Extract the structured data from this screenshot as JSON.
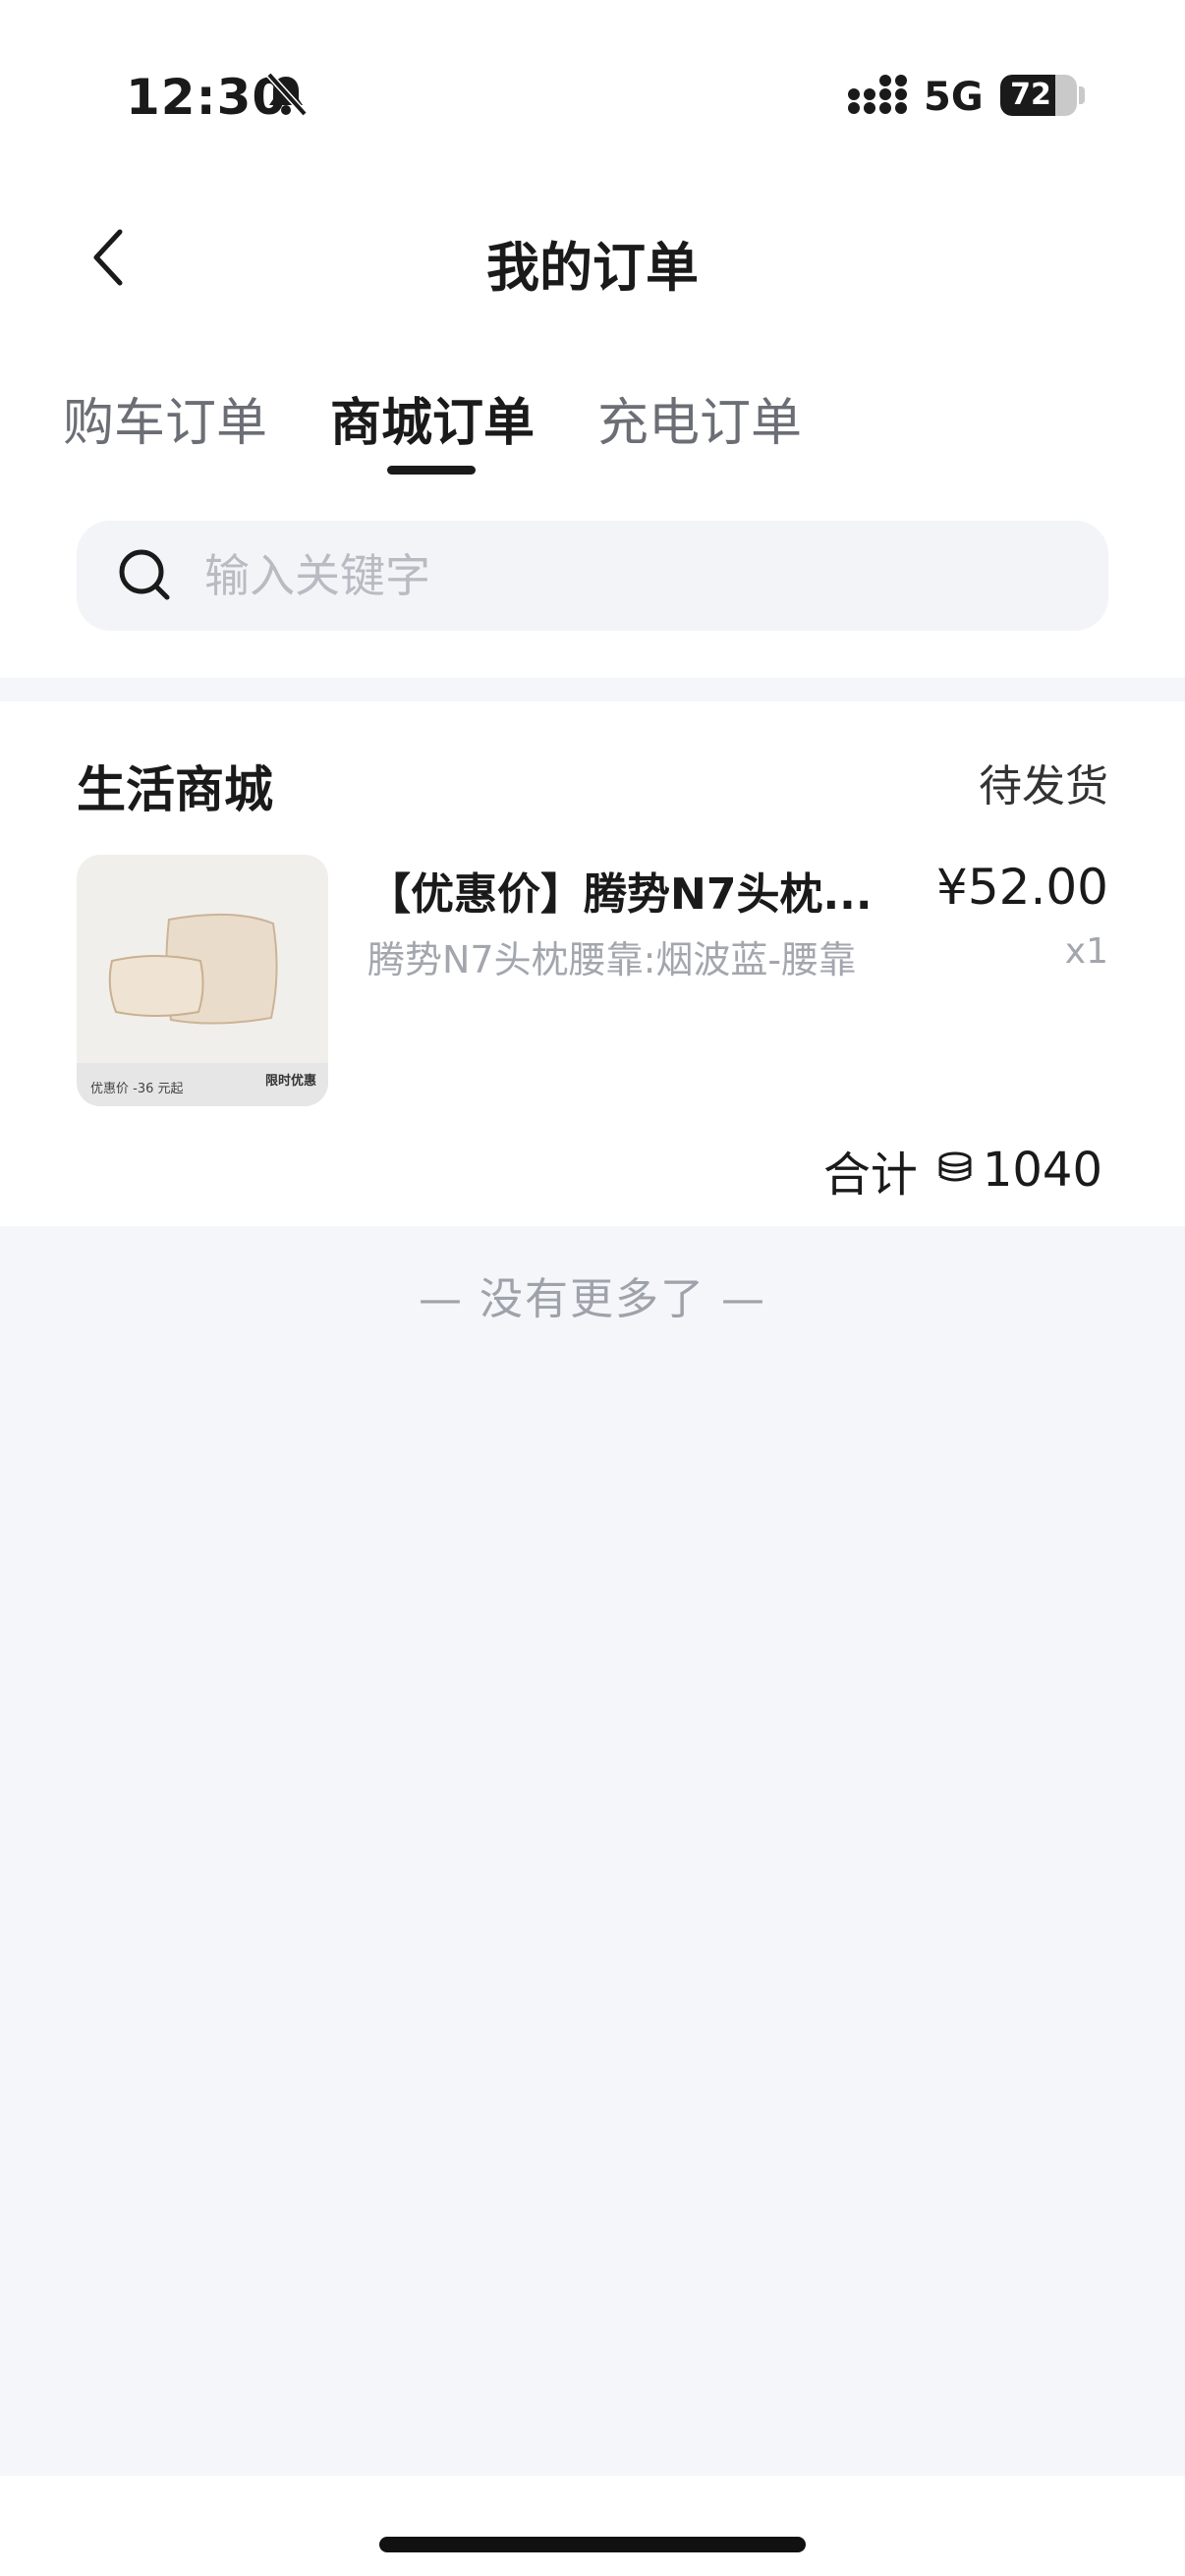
{
  "status_bar": {
    "time": "12:30",
    "network": "5G",
    "battery": "72",
    "battery_level": 0.72
  },
  "header": {
    "title": "我的订单"
  },
  "tabs": [
    {
      "label": "购车订单",
      "active": false
    },
    {
      "label": "商城订单",
      "active": true
    },
    {
      "label": "充电订单",
      "active": false
    }
  ],
  "search": {
    "placeholder": "输入关键字",
    "value": ""
  },
  "order": {
    "store": "生活商城",
    "status": "待发货",
    "product": {
      "name": "【优惠价】腾势N7头枕...",
      "price": "¥52.00",
      "variant": "腾势N7头枕腰靠:烟波蓝-腰靠",
      "quantity": "x1",
      "image_banner_left": "优惠价 -36 元起",
      "image_banner_right": "限时优惠"
    },
    "total_label": "合计",
    "total_value": "1040"
  },
  "footer": {
    "no_more": "— 没有更多了 —"
  },
  "colors": {
    "background": "#f5f6f9",
    "card": "#ffffff",
    "primary_text": "#1a1a1a",
    "muted_text": "#a3a6ad"
  }
}
